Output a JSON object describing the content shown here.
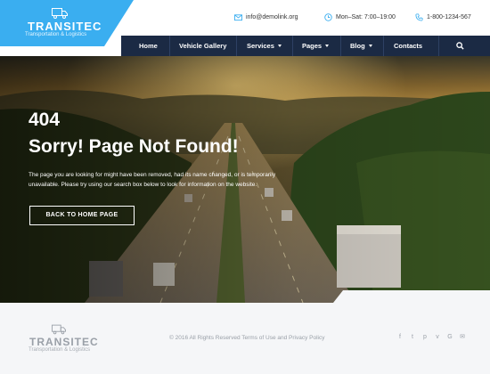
{
  "brand": {
    "name": "TRANSITEC",
    "tagline": "Transportation & Logistics"
  },
  "contacts": {
    "email": "info@demolink.org",
    "hours": "Mon–Sat: 7:00–19:00",
    "phone": "1-800-1234-567"
  },
  "nav": {
    "items": [
      {
        "label": "Home"
      },
      {
        "label": "Vehicle Gallery"
      },
      {
        "label": "Services"
      },
      {
        "label": "Pages"
      },
      {
        "label": "Blog"
      },
      {
        "label": "Contacts"
      }
    ]
  },
  "hero": {
    "code": "404",
    "title": "Sorry! Page Not Found!",
    "description": "The page you are looking for might have been removed, had its name changed, or is temporarily unavailable. Please try using our search box below to look for information on the website.",
    "button_label": "BACK TO HOME PAGE"
  },
  "footer": {
    "copyright": "© 2016 All Rights Reserved Terms of Use and Privacy Policy",
    "socials": [
      "f",
      "t",
      "p",
      "v",
      "G",
      "✉"
    ]
  },
  "colors": {
    "accent": "#3aaef0",
    "nav_bg": "#1b2a44",
    "footer_bg": "#f5f6f8"
  }
}
